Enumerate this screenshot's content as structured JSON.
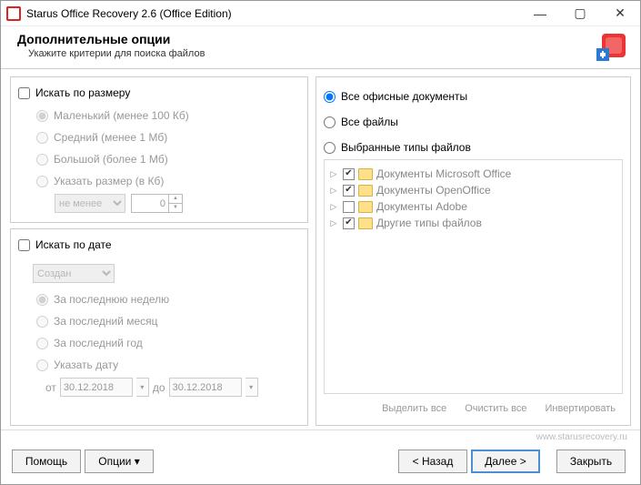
{
  "window": {
    "title": "Starus Office Recovery 2.6 (Office Edition)"
  },
  "header": {
    "title": "Дополнительные опции",
    "subtitle": "Укажите критерии для поиска файлов"
  },
  "size_panel": {
    "checkbox_label": "Искать по размеру",
    "options": {
      "small": "Маленький (менее 100 Кб)",
      "medium": "Средний (менее 1 Мб)",
      "large": "Большой (более 1 Мб)",
      "custom": "Указать размер (в Кб)"
    },
    "compare_select": "не менее",
    "value": "0"
  },
  "date_panel": {
    "checkbox_label": "Искать по дате",
    "date_type_select": "Создан",
    "options": {
      "last_week": "За последнюю неделю",
      "last_month": "За последний месяц",
      "last_year": "За последний год",
      "custom": "Указать дату"
    },
    "from_label": "от",
    "from_value": "30.12.2018",
    "to_label": "до",
    "to_value": "30.12.2018"
  },
  "types_panel": {
    "radio_all_office": "Все офисные документы",
    "radio_all_files": "Все файлы",
    "radio_selected": "Выбранные типы файлов",
    "tree": [
      {
        "label": "Документы Microsoft Office",
        "checked": true
      },
      {
        "label": "Документы OpenOffice",
        "checked": true
      },
      {
        "label": "Документы Adobe",
        "checked": false
      },
      {
        "label": "Другие типы файлов",
        "checked": true
      }
    ],
    "actions": {
      "select_all": "Выделить все",
      "clear_all": "Очистить все",
      "invert": "Инвертировать"
    }
  },
  "footer": {
    "help": "Помощь",
    "options": "Опции ▾",
    "back": "< Назад",
    "next": "Далее >",
    "close": "Закрыть",
    "website": "www.starusrecovery.ru"
  }
}
